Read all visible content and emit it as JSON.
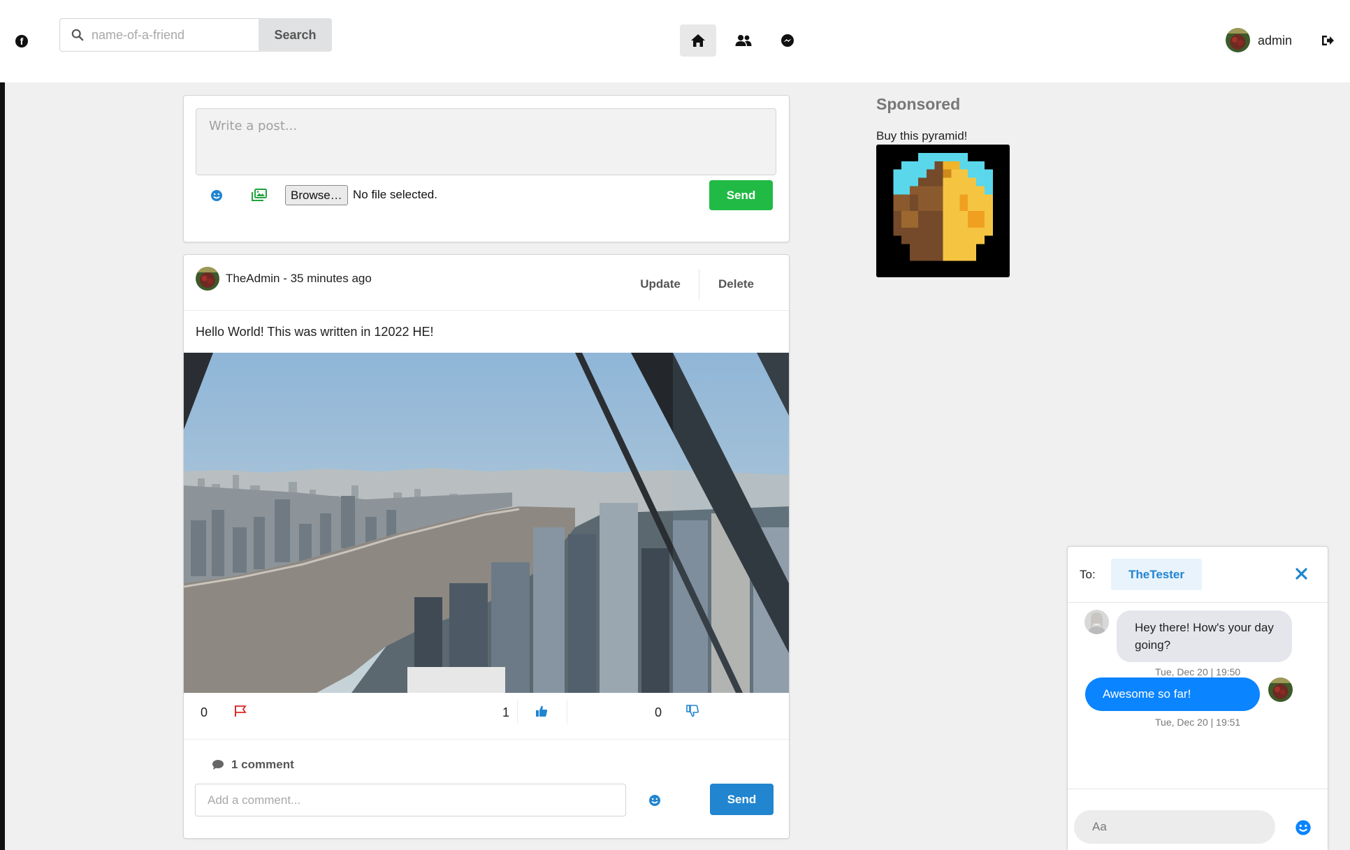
{
  "topbar": {
    "logo_icon": "facebook-icon",
    "search": {
      "placeholder": "name-of-a-friend",
      "button_label": "Search"
    },
    "nav": [
      {
        "icon": "home-icon",
        "active": true
      },
      {
        "icon": "friends-icon",
        "active": false
      },
      {
        "icon": "messenger-icon",
        "active": false
      }
    ],
    "user": {
      "name": "admin"
    },
    "logout_icon": "sign-out-icon"
  },
  "composer": {
    "placeholder": "Write a post...",
    "browse_label": "Browse…",
    "file_status": "No file selected.",
    "send_label": "Send",
    "icons": [
      "smile-icon",
      "images-icon"
    ]
  },
  "post": {
    "author_line": "TheAdmin - 35 minutes ago",
    "update_label": "Update",
    "delete_label": "Delete",
    "text": "Hello World! This was written in 12022 HE!",
    "stats": {
      "reports": "0",
      "likes": "1",
      "dislikes": "0"
    },
    "comments_label": "1 comment",
    "comment_placeholder": "Add a comment...",
    "comment_send_label": "Send"
  },
  "sponsored": {
    "title": "Sponsored",
    "caption": "Buy this pyramid!"
  },
  "chat": {
    "to_label": "To:",
    "recipient": "TheTester",
    "messages": [
      {
        "direction": "in",
        "text": "Hey there! How's your day going?",
        "time": "Tue, Dec 20 | 19:50"
      },
      {
        "direction": "out",
        "text": "Awesome so far!",
        "time": "Tue, Dec 20 | 19:51"
      }
    ],
    "input_placeholder": "Aa"
  },
  "colors": {
    "green": "#21ba45",
    "blue": "#2185d0",
    "messenger_blue": "#0a84ff",
    "red_flag": "#db2828"
  }
}
